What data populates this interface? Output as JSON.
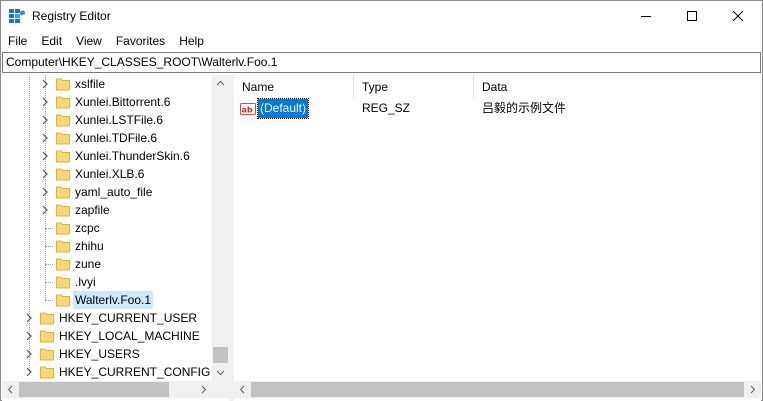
{
  "window": {
    "title": "Registry Editor"
  },
  "menu": [
    "File",
    "Edit",
    "View",
    "Favorites",
    "Help"
  ],
  "address": "Computer\\HKEY_CLASSES_ROOT\\Walterlv.Foo.1",
  "tree": [
    {
      "label": "xslfile",
      "expandable": true
    },
    {
      "label": "Xunlei.Bittorrent.6",
      "expandable": true
    },
    {
      "label": "Xunlei.LSTFile.6",
      "expandable": true
    },
    {
      "label": "Xunlei.TDFile.6",
      "expandable": true
    },
    {
      "label": "Xunlei.ThunderSkin.6",
      "expandable": true
    },
    {
      "label": "Xunlei.XLB.6",
      "expandable": true
    },
    {
      "label": "yaml_auto_file",
      "expandable": true
    },
    {
      "label": "zapfile",
      "expandable": true
    },
    {
      "label": "zcpc",
      "expandable": false
    },
    {
      "label": "zhihu",
      "expandable": false
    },
    {
      "label": "zune",
      "expandable": false
    },
    {
      "label": ".lvyi",
      "expandable": false
    },
    {
      "label": "Walterlv.Foo.1",
      "expandable": false,
      "selected": true
    },
    {
      "label": "HKEY_CURRENT_USER",
      "expandable": true,
      "root": true
    },
    {
      "label": "HKEY_LOCAL_MACHINE",
      "expandable": true,
      "root": true
    },
    {
      "label": "HKEY_USERS",
      "expandable": true,
      "root": true
    },
    {
      "label": "HKEY_CURRENT_CONFIG",
      "expandable": true,
      "root": true
    }
  ],
  "list": {
    "columns": [
      "Name",
      "Type",
      "Data"
    ],
    "rows": [
      {
        "name": "(Default)",
        "type": "REG_SZ",
        "data": "吕毅的示例文件",
        "icon": "string-value-icon"
      }
    ]
  },
  "colors": {
    "selection": "#0078d7",
    "tree_selection": "#cce8ff",
    "folder": "#f8d775"
  }
}
